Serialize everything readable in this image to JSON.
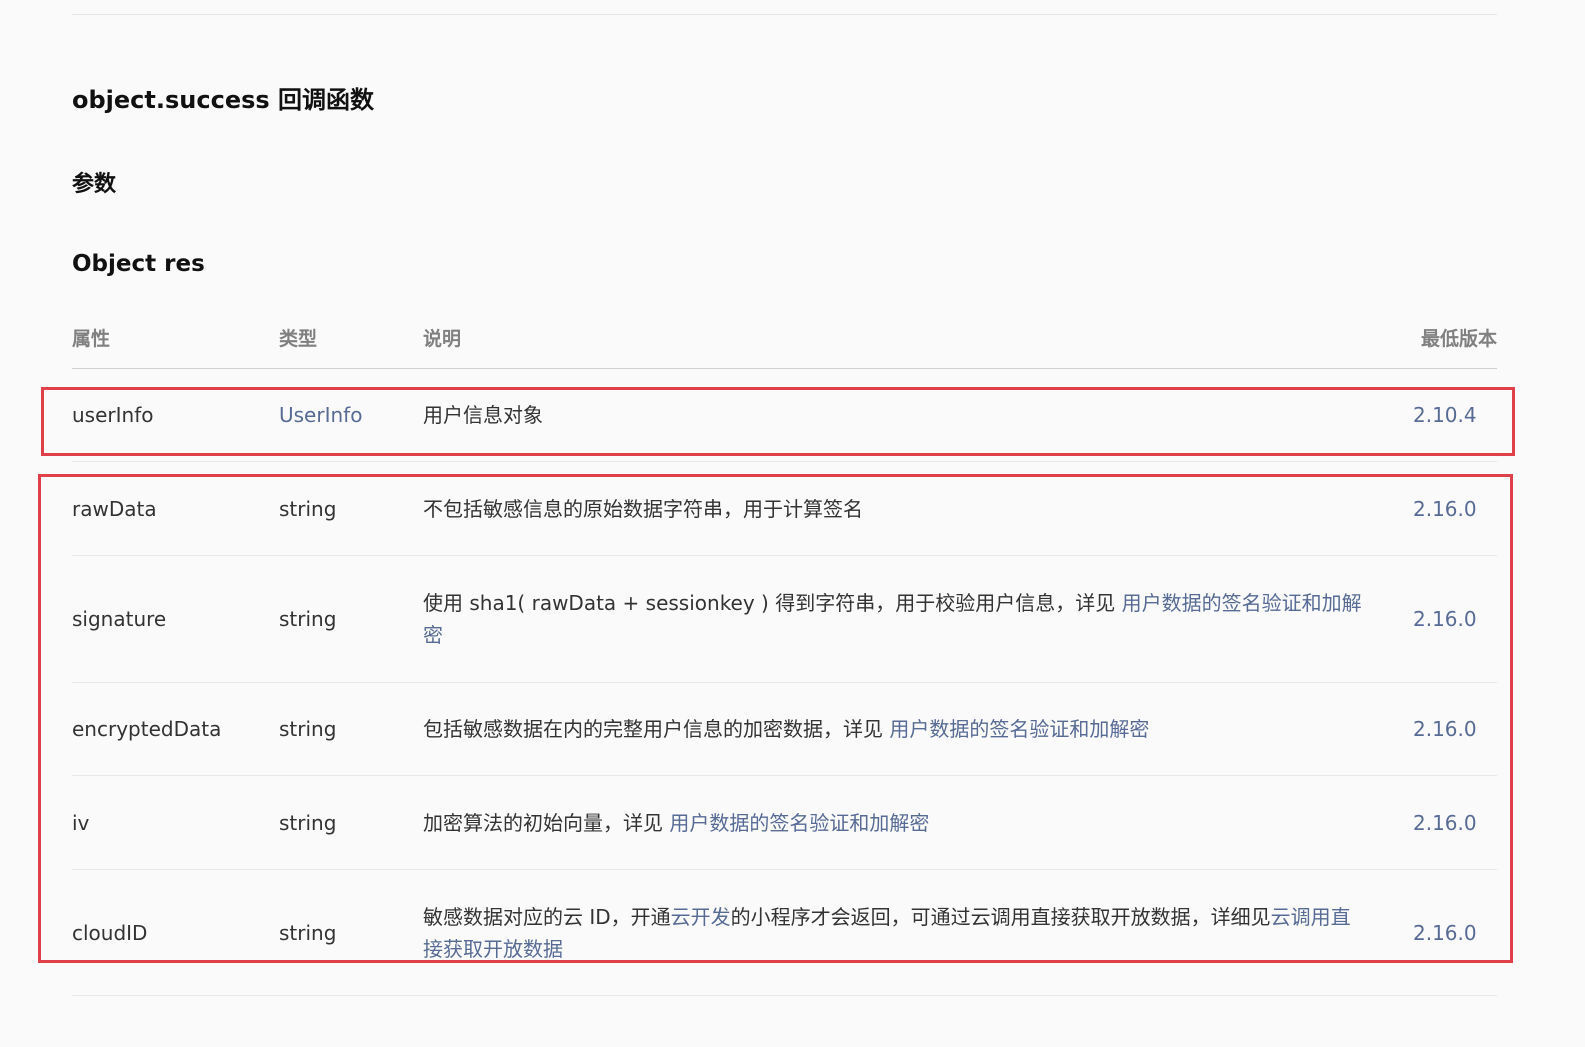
{
  "section_title": "object.success 回调函数",
  "params_heading": "参数",
  "object_heading": "Object res",
  "table": {
    "headers": {
      "attr": "属性",
      "type": "类型",
      "desc": "说明",
      "version": "最低版本"
    },
    "rows": [
      {
        "attr": "userInfo",
        "type": "UserInfo",
        "desc_parts": [
          "用户信息对象"
        ],
        "version": "2.10.4"
      },
      {
        "attr": "rawData",
        "type": "string",
        "desc_parts": [
          "不包括敏感信息的原始数据字符串，用于计算签名"
        ],
        "version": "2.16.0"
      },
      {
        "attr": "signature",
        "type": "string",
        "desc_parts": [
          "使用 sha1( rawData + sessionkey ) 得到字符串，用于校验用户信息，详见 ",
          "用户数据的签名验证和加解密"
        ],
        "version": "2.16.0"
      },
      {
        "attr": "encryptedData",
        "type": "string",
        "desc_parts": [
          "包括敏感数据在内的完整用户信息的加密数据，详见 ",
          "用户数据的签名验证和加解密"
        ],
        "version": "2.16.0"
      },
      {
        "attr": "iv",
        "type": "string",
        "desc_parts": [
          "加密算法的初始向量，详见 ",
          "用户数据的签名验证和加解密"
        ],
        "version": "2.16.0"
      },
      {
        "attr": "cloudID",
        "type": "string",
        "desc_parts": [
          "敏感数据对应的云 ID，开通",
          "云开发",
          "的小程序才会返回，可通过云调用直接获取开放数据，详细见",
          "云调用直接获取开放数据"
        ],
        "version": "2.16.0"
      }
    ]
  },
  "colors": {
    "link": "#576b95",
    "highlight_border": "#e0404a",
    "header_text": "#808080"
  }
}
